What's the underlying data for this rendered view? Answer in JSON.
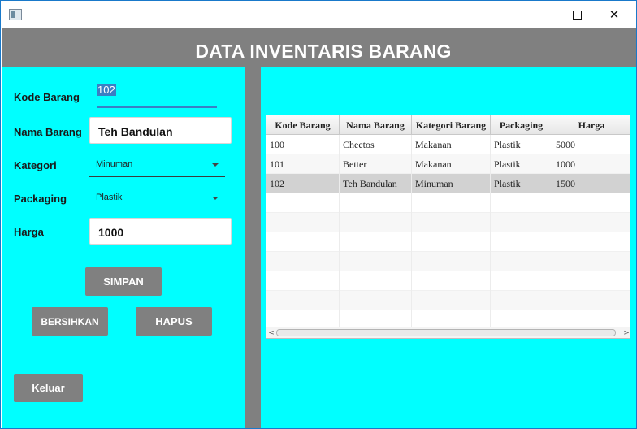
{
  "window": {
    "minimize_glyph": "",
    "maximize_glyph": "",
    "close_glyph": "✕"
  },
  "header": {
    "title": "DATA INVENTARIS BARANG"
  },
  "form": {
    "kode_label": "Kode Barang",
    "kode_value": "102",
    "nama_label": "Nama Barang",
    "nama_value": "Teh Bandulan",
    "kategori_label": "Kategori",
    "kategori_value": "Minuman",
    "packaging_label": "Packaging",
    "packaging_value": "Plastik",
    "harga_label": "Harga",
    "harga_value": "1000"
  },
  "buttons": {
    "simpan": "SIMPAN",
    "bersihkan": "BERSIHKAN",
    "hapus": "HAPUS",
    "keluar": "Keluar"
  },
  "table": {
    "columns": [
      "Kode Barang",
      "Nama Barang",
      "Kategori Barang",
      "Packaging",
      "Harga"
    ],
    "rows": [
      [
        "100",
        "Cheetos",
        "Makanan",
        "Plastik",
        "5000"
      ],
      [
        "101",
        "Better",
        "Makanan",
        "Plastik",
        "1000"
      ],
      [
        "102",
        "Teh Bandulan",
        "Minuman",
        "Plastik",
        "1500"
      ]
    ],
    "selected_row": 2,
    "scroll_left_glyph": "<",
    "scroll_right_glyph": ">"
  },
  "colors": {
    "panel": "#00ffff",
    "header": "#808080",
    "accent": "#3a7fc4"
  }
}
